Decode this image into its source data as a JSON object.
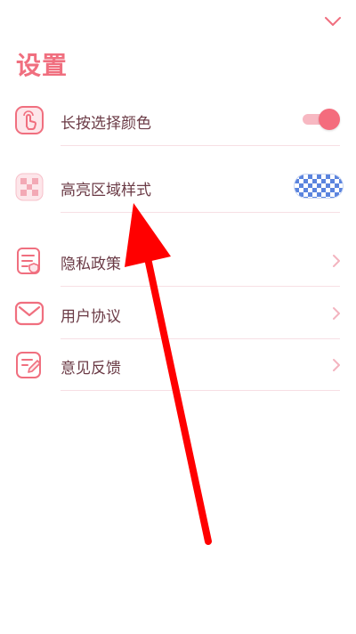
{
  "header": {
    "title": "设置",
    "collapse_icon": "chevron-down-icon"
  },
  "settings": [
    {
      "label": "长按选择颜色",
      "icon": "long-press-hand-icon",
      "control": "toggle",
      "state": "on"
    },
    {
      "label": "高亮区域样式",
      "icon": "checkerboard-icon",
      "control": "pattern-swatch"
    },
    {
      "label": "隐私政策",
      "icon": "document-shield-icon",
      "control": "chevron"
    },
    {
      "label": "用户协议",
      "icon": "envelope-icon",
      "control": "chevron"
    },
    {
      "label": "意见反馈",
      "icon": "edit-note-icon",
      "control": "chevron"
    }
  ],
  "colors": {
    "accent": "#f06f7f",
    "label": "#6b3b46",
    "divider": "#f7dfe4",
    "swatch_blue": "#5b84de",
    "annotation_arrow": "#ff0000"
  }
}
